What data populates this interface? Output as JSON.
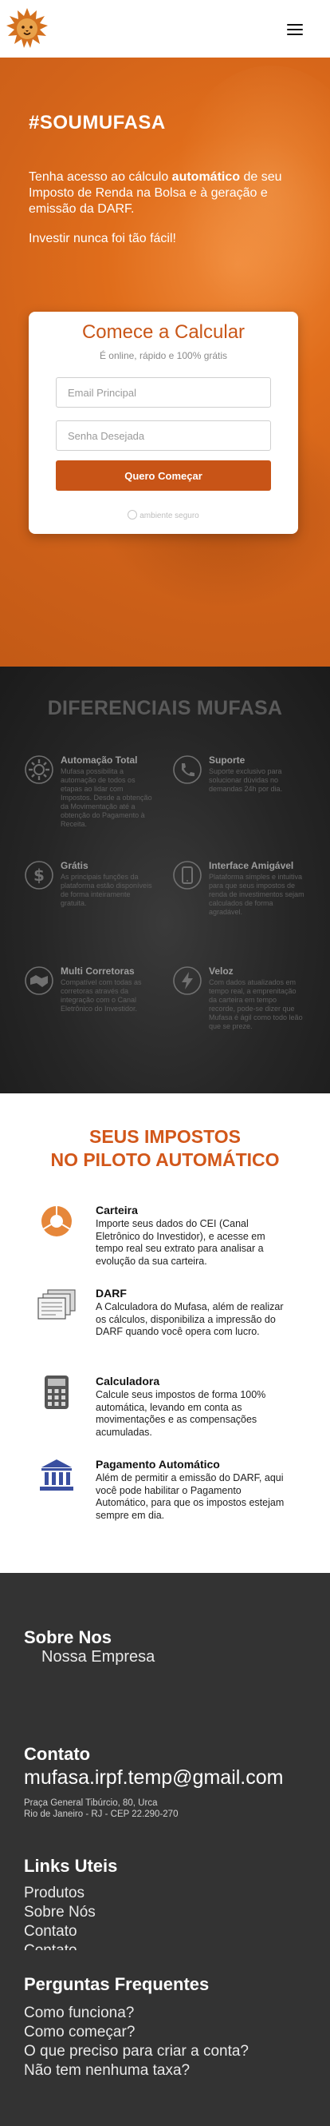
{
  "header": {
    "logo_name": "mufasa-lion-logo",
    "menu_icon": "hamburger-icon"
  },
  "hero": {
    "tag": "#SOUMUFASA",
    "text_1": "Tenha acesso ao cálculo ",
    "text_bold": "automático",
    "text_2": " de seu Imposto de Renda na Bolsa e à geração e emissão da DARF.",
    "sub": "Investir nunca foi tão fácil!"
  },
  "signup": {
    "title": "Comece a Calcular",
    "subtitle": "É online, rápido e 100% grátis",
    "email_placeholder": "Email Principal",
    "password_placeholder": "Senha Desejada",
    "button": "Quero Começar",
    "secure": "ambiente seguro"
  },
  "differentials": {
    "title": "DIFERENCIAIS MUFASA",
    "items": [
      {
        "title": "Automação Total",
        "desc": "Mufasa possibilita a automação de todos os etapas ao lidar com Impostos. Desde a obtenção da Movimentação até a obtenção do Pagamento à Receita.",
        "icon": "gear-icon"
      },
      {
        "title": "Suporte",
        "desc": "Suporte exclusivo para solucionar dúvidas no demandas 24h por dia.",
        "icon": "phone-support-icon"
      },
      {
        "title": "Grátis",
        "desc": "As principais funções da plataforma estão disponíveis de forma inteiramente gratuita.",
        "icon": "dollar-icon"
      },
      {
        "title": "Interface Amigável",
        "desc": "Plataforma simples e intuitiva para que seus impostos de renda de investimentos sejam calculados de forma agradável.",
        "icon": "mobile-icon"
      },
      {
        "title": "Multi Corretoras",
        "desc": "Compatível com todas as corretoras através da integração com o Canal Eletrônico do Investidor.",
        "icon": "handshake-icon"
      },
      {
        "title": "Veloz",
        "desc": "Com dados atualizados em tempo real, a emprenitação da carteira em tempo recorde, pode-se dizer que Mufasa é ágil como todo leão que se preze.",
        "icon": "lightning-icon"
      }
    ]
  },
  "taxes": {
    "title_1": "SEUS IMPOSTOS",
    "title_2": "NO PILOTO AUTOMÁTICO",
    "items": [
      {
        "title": "Carteira",
        "desc": "Importe seus dados do CEI (Canal Eletrônico do Investidor), e acesse em tempo real seu extrato para analisar a evolução da sua carteira.",
        "icon": "pie-chart-icon"
      },
      {
        "title": "DARF",
        "desc": "A Calculadora do Mufasa, além de realizar os cálculos, disponibiliza a impressão do DARF quando você opera com lucro.",
        "icon": "documents-icon"
      },
      {
        "title": "Calculadora",
        "desc": "Calcule seus impostos de forma 100% automática, levando em conta as movimentações e as compensações acumuladas.",
        "icon": "calculator-icon"
      },
      {
        "title": "Pagamento Automático",
        "desc": "Além de permitir a emissão do DARF, aqui você pode habilitar o Pagamento Automático, para que os impostos estejam sempre em dia.",
        "icon": "bank-icon"
      }
    ]
  },
  "footer": {
    "about_title": "Sobre Nos",
    "about_link": "Nossa Empresa",
    "contact_title": "Contato",
    "email": "mufasa.irpf.temp@gmail.com",
    "address_1": "Praça General Tibúrcio, 80, Urca",
    "address_2": "Rio de Janeiro - RJ - CEP 22.290-270",
    "links_title": "Links Uteis",
    "links": [
      "Produtos",
      "Sobre Nós",
      "Contato",
      "Contato"
    ],
    "faq_title": "Perguntas Frequentes",
    "faq": [
      "Como funciona?",
      "Como começar?",
      "O que preciso para criar a conta?",
      "Não tem nenhuma taxa?"
    ]
  },
  "colors": {
    "brand_orange": "#c85417",
    "dark_bg": "#262626",
    "footer_bg": "#333333"
  }
}
